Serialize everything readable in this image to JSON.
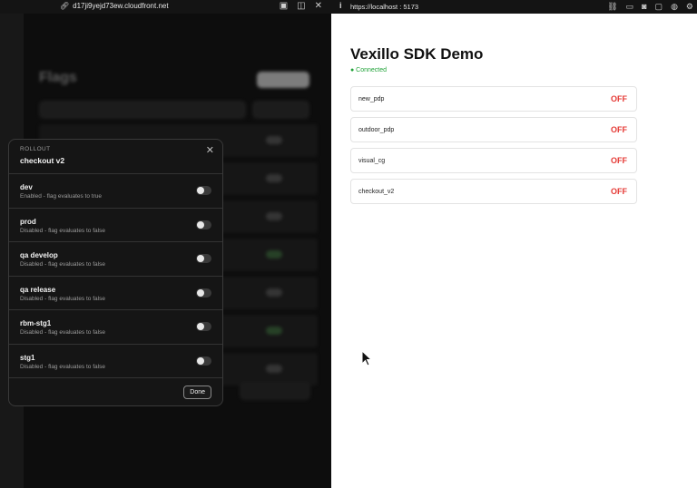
{
  "left_window": {
    "url": "d17ji9yejd73ew.cloudfront.net",
    "background_app": {
      "title": "Flags"
    },
    "modal": {
      "eyebrow": "ROLLOUT",
      "title": "checkout v2",
      "environments": [
        {
          "name": "dev",
          "description": "Enabled - flag evaluates to true"
        },
        {
          "name": "prod",
          "description": "Disabled - flag evaluates to false"
        },
        {
          "name": "qa develop",
          "description": "Disabled - flag evaluates to false"
        },
        {
          "name": "qa release",
          "description": "Disabled - flag evaluates to false"
        },
        {
          "name": "rbm-stg1",
          "description": "Disabled - flag evaluates to false"
        },
        {
          "name": "stg1",
          "description": "Disabled - flag evaluates to false"
        }
      ],
      "done_label": "Done"
    }
  },
  "right_window": {
    "url": "https://localhost : 5173",
    "title": "Vexillo SDK Demo",
    "status": "● Connected",
    "flags": [
      {
        "name": "new_pdp",
        "value": "OFF"
      },
      {
        "name": "outdoor_pdp",
        "value": "OFF"
      },
      {
        "name": "visual_cg",
        "value": "OFF"
      },
      {
        "name": "checkout_v2",
        "value": "OFF"
      }
    ]
  },
  "colors": {
    "connected": "#22a33a",
    "off": "#e53935"
  }
}
